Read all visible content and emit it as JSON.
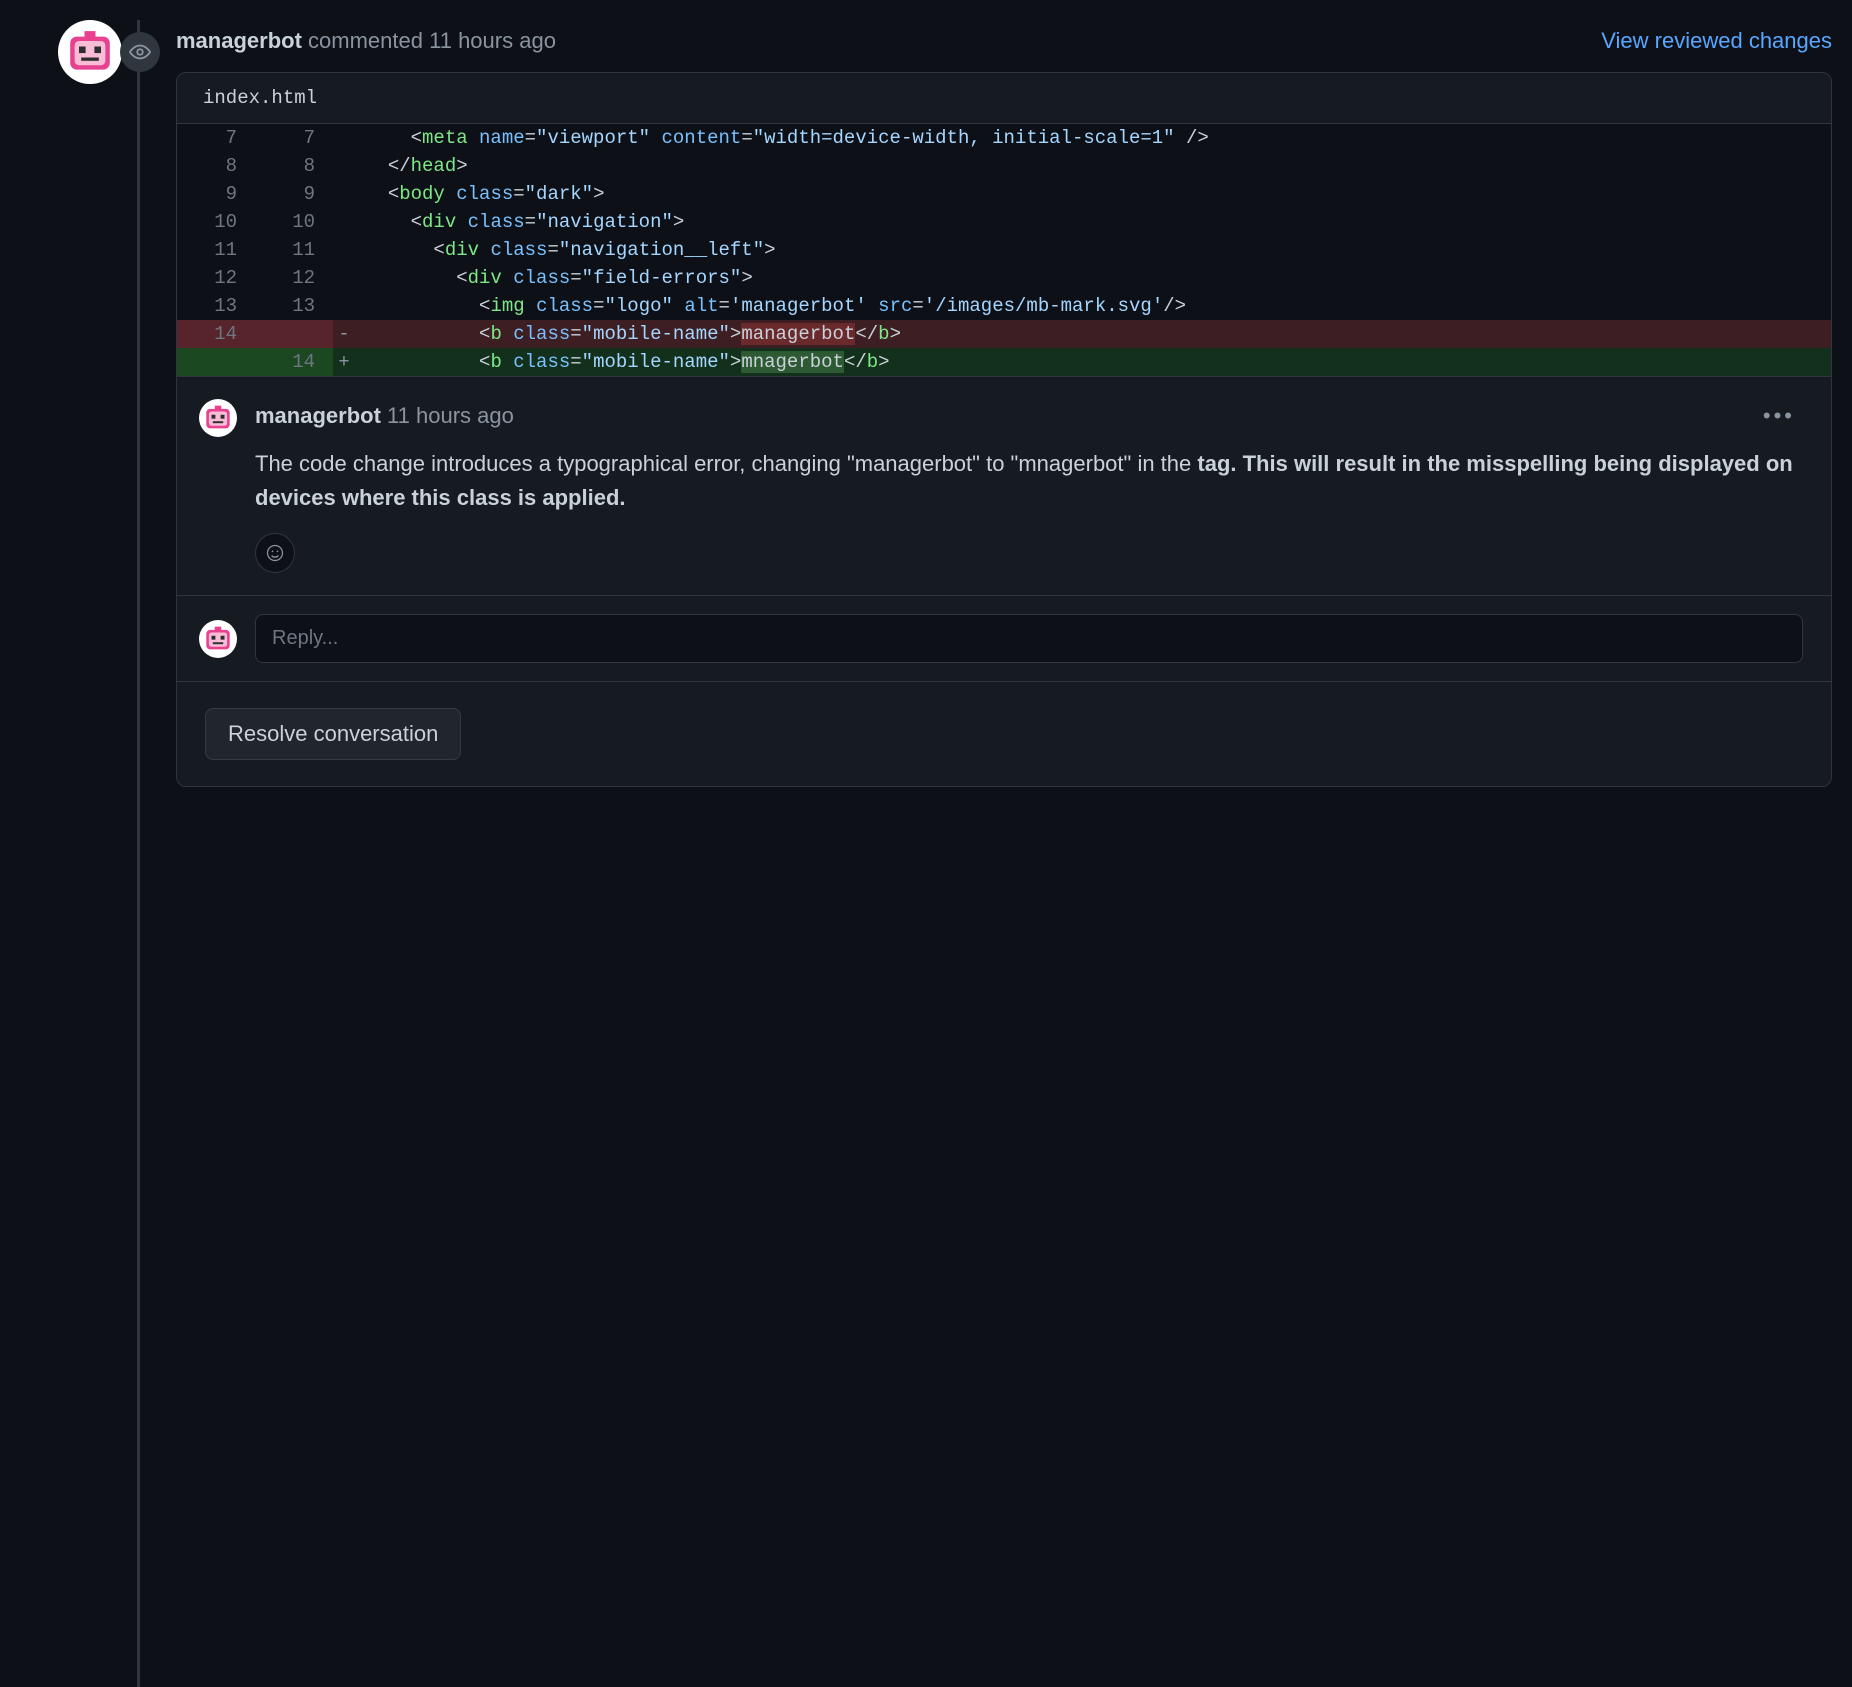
{
  "header": {
    "author": "managerbot",
    "verb": "commented",
    "time": "11 hours ago",
    "view_link": "View reviewed changes"
  },
  "file": {
    "name": "index.html"
  },
  "diff": [
    {
      "o": "7",
      "n": "7",
      "s": " ",
      "kind": "ctx",
      "html": "    <span class='t-pun'>&lt;</span><span class='t-tag'>meta</span> <span class='t-attr'>name</span>=<span class='t-str'>\"viewport\"</span> <span class='t-attr'>content</span>=<span class='t-str'>\"width=device-width, initial-scale=1\"</span> <span class='t-pun'>/&gt;</span>"
    },
    {
      "o": "8",
      "n": "8",
      "s": " ",
      "kind": "ctx",
      "html": "  <span class='t-pun'>&lt;/</span><span class='t-tag'>head</span><span class='t-pun'>&gt;</span>"
    },
    {
      "o": "9",
      "n": "9",
      "s": " ",
      "kind": "ctx",
      "html": "  <span class='t-pun'>&lt;</span><span class='t-tag'>body</span> <span class='t-attr'>class</span>=<span class='t-str'>\"dark\"</span><span class='t-pun'>&gt;</span>"
    },
    {
      "o": "10",
      "n": "10",
      "s": " ",
      "kind": "ctx",
      "html": "    <span class='t-pun'>&lt;</span><span class='t-tag'>div</span> <span class='t-attr'>class</span>=<span class='t-str'>\"navigation\"</span><span class='t-pun'>&gt;</span>"
    },
    {
      "o": "11",
      "n": "11",
      "s": " ",
      "kind": "ctx",
      "html": "      <span class='t-pun'>&lt;</span><span class='t-tag'>div</span> <span class='t-attr'>class</span>=<span class='t-str'>\"navigation__left\"</span><span class='t-pun'>&gt;</span>"
    },
    {
      "o": "12",
      "n": "12",
      "s": " ",
      "kind": "ctx",
      "html": "        <span class='t-pun'>&lt;</span><span class='t-tag'>div</span> <span class='t-attr'>class</span>=<span class='t-str'>\"field-errors\"</span><span class='t-pun'>&gt;</span>"
    },
    {
      "o": "13",
      "n": "13",
      "s": " ",
      "kind": "ctx",
      "html": "          <span class='t-pun'>&lt;</span><span class='t-tag'>img</span> <span class='t-attr'>class</span>=<span class='t-str'>\"logo\"</span> <span class='t-attr'>alt</span>=<span class='t-str'>'managerbot'</span> <span class='t-attr'>src</span>=<span class='t-str'>'/images/mb-mark.svg'</span><span class='t-pun'>/&gt;</span>"
    },
    {
      "o": "14",
      "n": "",
      "s": "-",
      "kind": "del",
      "html": "          <span class='t-pun'>&lt;</span><span class='t-tag'>b</span> <span class='t-attr'>class</span>=<span class='t-str'>\"mobile-name\"</span><span class='t-pun'>&gt;</span><span class='del-mark'>managerbot</span><span class='t-pun'>&lt;/</span><span class='t-tag'>b</span><span class='t-pun'>&gt;</span>"
    },
    {
      "o": "",
      "n": "14",
      "s": "+",
      "kind": "add",
      "html": "          <span class='t-pun'>&lt;</span><span class='t-tag'>b</span> <span class='t-attr'>class</span>=<span class='t-str'>\"mobile-name\"</span><span class='t-pun'>&gt;</span><span class='add-mark'>mnagerbot</span><span class='t-pun'>&lt;/</span><span class='t-tag'>b</span><span class='t-pun'>&gt;</span>"
    }
  ],
  "comment": {
    "author": "managerbot",
    "time": "11 hours ago",
    "text_plain": "The code change introduces a typographical error, changing \"managerbot\" to \"mnagerbot\" in the ",
    "text_bold": "tag. This will result in the misspelling being displayed on devices where this class is applied."
  },
  "reply": {
    "placeholder": "Reply..."
  },
  "actions": {
    "resolve": "Resolve conversation"
  }
}
